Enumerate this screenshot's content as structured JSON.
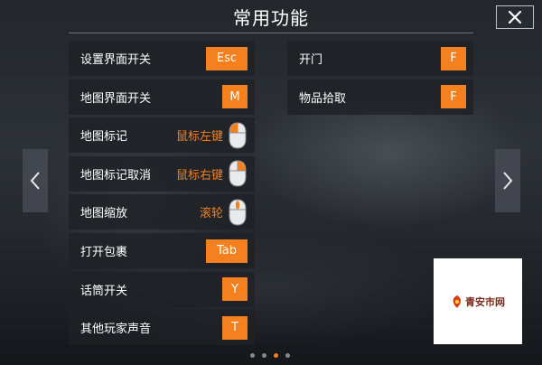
{
  "title": "常用功能",
  "left_column": [
    {
      "label": "设置界面开关",
      "type": "key",
      "key": "Esc",
      "wide": true
    },
    {
      "label": "地图界面开关",
      "type": "key",
      "key": "M",
      "wide": false
    },
    {
      "label": "地图标记",
      "type": "mouse",
      "mouse_text": "鼠标左键",
      "mouse_button": "left"
    },
    {
      "label": "地图标记取消",
      "type": "mouse",
      "mouse_text": "鼠标右键",
      "mouse_button": "right"
    },
    {
      "label": "地图缩放",
      "type": "mouse",
      "mouse_text": "滚轮",
      "mouse_button": "wheel"
    },
    {
      "label": "打开包裹",
      "type": "key",
      "key": "Tab",
      "wide": true
    },
    {
      "label": "话筒开关",
      "type": "key",
      "key": "Y",
      "wide": false
    },
    {
      "label": "其他玩家声音",
      "type": "key",
      "key": "T",
      "wide": false
    }
  ],
  "right_column": [
    {
      "label": "开门",
      "type": "key",
      "key": "F",
      "wide": false
    },
    {
      "label": "物品拾取",
      "type": "key",
      "key": "F",
      "wide": false
    }
  ],
  "pagination": {
    "total": 4,
    "active_index": 2
  },
  "watermark": {
    "text": "青安市网"
  },
  "colors": {
    "accent": "#f5801f",
    "row_bg": "#1e2126",
    "text": "#ffffff"
  },
  "icons": {
    "close": "close-icon",
    "prev": "chevron-left-icon",
    "next": "chevron-right-icon",
    "mouse": "mouse-icon"
  }
}
